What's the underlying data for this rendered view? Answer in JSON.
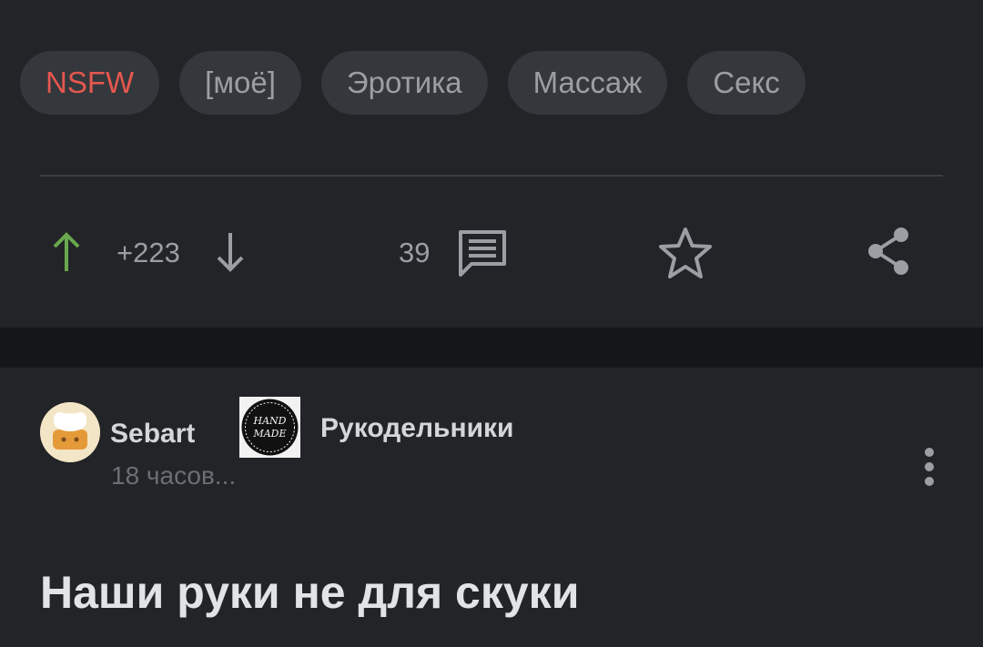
{
  "tags": [
    "NSFW",
    "[моё]",
    "Эротика",
    "Массаж",
    "Секс"
  ],
  "actions": {
    "rating": "+223",
    "comments_count": "39"
  },
  "post": {
    "author": "Sebart",
    "time": "18 часов...",
    "community": "Рукодельники",
    "community_logo_text": [
      "HAND",
      "MADE"
    ],
    "title": "Наши руки не для скуки"
  },
  "colors": {
    "background": "#222427",
    "separator": "#151617",
    "tag_background": "#34373b",
    "nsfw_text": "#e4574f",
    "upvote": "#6aa84f",
    "icon": "#9b9fa4"
  },
  "icons": [
    "arrow-up-icon",
    "arrow-down-icon",
    "comments-icon",
    "star-icon",
    "share-icon",
    "more-vertical-icon"
  ]
}
